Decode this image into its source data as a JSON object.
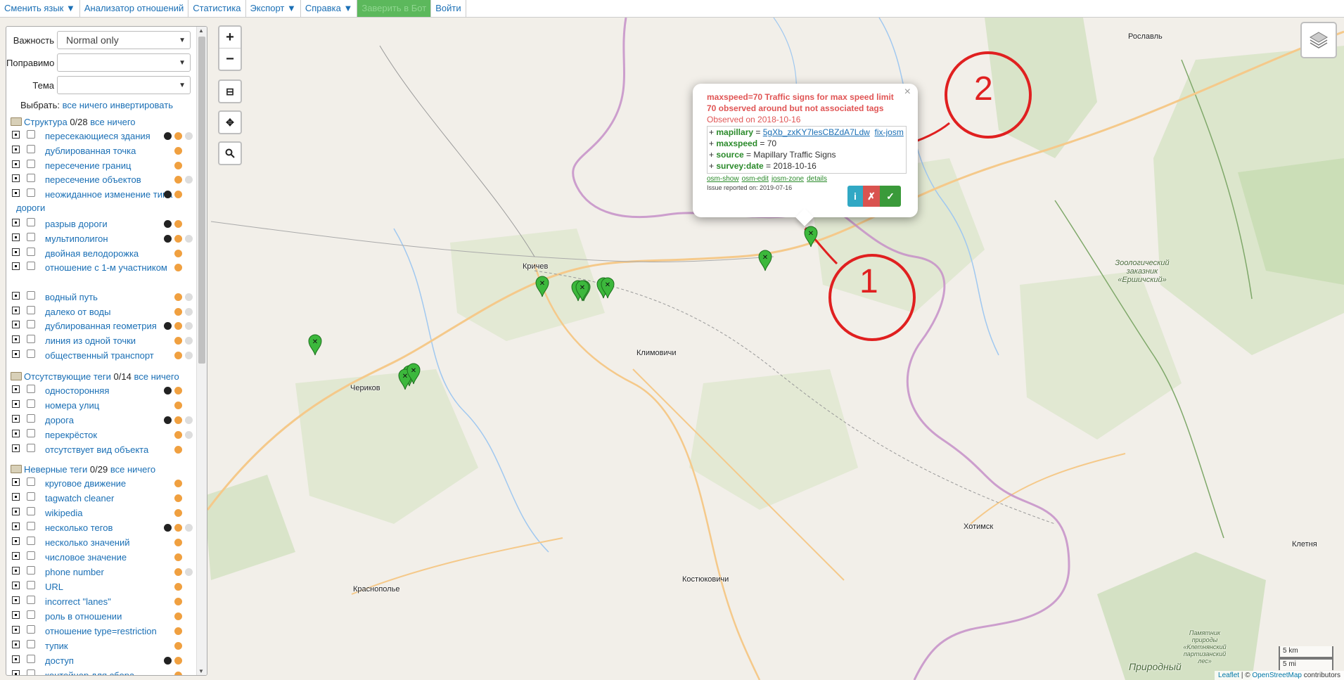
{
  "menu": [
    {
      "label": "Сменить язык ▼"
    },
    {
      "label": "Анализатор отношений"
    },
    {
      "label": "Статистика"
    },
    {
      "label": "Экспорт ▼"
    },
    {
      "label": "Справка ▼"
    },
    {
      "label": "Заверить в Бот"
    },
    {
      "label": "Войти"
    }
  ],
  "filters": {
    "importance": {
      "label": "Важность",
      "value": "Normal only"
    },
    "fixable": {
      "label": "Поправимо",
      "value": ""
    },
    "theme": {
      "label": "Тема",
      "value": ""
    },
    "choose": {
      "label": "Выбрать:",
      "all": "все",
      "none": "ничего",
      "invert": "инвертировать"
    }
  },
  "categories": [
    {
      "name": "Структура",
      "count": "0/28",
      "all": "все",
      "none": "ничего",
      "items": [
        {
          "label": "пересекающиеся здания",
          "dots": [
            "dark",
            "orange",
            "grey"
          ]
        },
        {
          "label": "дублированная точка",
          "dots": [
            "orange"
          ]
        },
        {
          "label": "пересечение границ",
          "dots": [
            "orange"
          ]
        },
        {
          "label": "пересечение объектов",
          "dots": [
            "orange",
            "grey"
          ]
        },
        {
          "label": "неожиданное изменение типа дороги",
          "dots": [
            "dark",
            "orange"
          ]
        },
        {
          "label": "разрыв дороги",
          "dots": [
            "dark",
            "orange"
          ]
        },
        {
          "label": "мультиполигон",
          "dots": [
            "dark",
            "orange",
            "grey"
          ]
        },
        {
          "label": "двойная велодорожка",
          "dots": [
            "orange"
          ]
        },
        {
          "label": "отношение с 1-м участником",
          "dots": [
            "orange"
          ]
        },
        {
          "label": "водный путь",
          "dots": [
            "orange",
            "grey"
          ]
        },
        {
          "label": "далеко от воды",
          "dots": [
            "orange",
            "grey"
          ]
        },
        {
          "label": "дублированная геометрия",
          "dots": [
            "dark",
            "orange",
            "grey"
          ]
        },
        {
          "label": "линия из одной точки",
          "dots": [
            "orange",
            "grey"
          ]
        },
        {
          "label": "общественный транспорт",
          "dots": [
            "orange",
            "grey"
          ]
        }
      ]
    },
    {
      "name": "Отсутствующие теги",
      "count": "0/14",
      "all": "все",
      "none": "ничего",
      "items": [
        {
          "label": "односторонняя",
          "dots": [
            "dark",
            "orange"
          ]
        },
        {
          "label": "номера улиц",
          "dots": [
            "orange"
          ]
        },
        {
          "label": "дорога",
          "dots": [
            "dark",
            "orange",
            "grey"
          ]
        },
        {
          "label": "перекрёсток",
          "dots": [
            "orange",
            "grey"
          ]
        },
        {
          "label": "отсутствует вид объекта",
          "dots": [
            "orange"
          ]
        }
      ]
    },
    {
      "name": "Неверные теги",
      "count": "0/29",
      "all": "все",
      "none": "ничего",
      "items": [
        {
          "label": "круговое движение",
          "dots": [
            "orange"
          ]
        },
        {
          "label": "tagwatch cleaner",
          "dots": [
            "orange"
          ]
        },
        {
          "label": "wikipedia",
          "dots": [
            "orange"
          ]
        },
        {
          "label": "несколько тегов",
          "dots": [
            "dark",
            "orange",
            "grey"
          ]
        },
        {
          "label": "несколько значений",
          "dots": [
            "orange"
          ]
        },
        {
          "label": "числовое значение",
          "dots": [
            "orange"
          ]
        },
        {
          "label": "phone number",
          "dots": [
            "orange",
            "grey"
          ]
        },
        {
          "label": "URL",
          "dots": [
            "orange"
          ]
        },
        {
          "label": "incorrect \"lanes\"",
          "dots": [
            "orange"
          ]
        },
        {
          "label": "роль в отношении",
          "dots": [
            "orange"
          ]
        },
        {
          "label": "отношение type=restriction",
          "dots": [
            "orange"
          ]
        },
        {
          "label": "тупик",
          "dots": [
            "orange"
          ]
        },
        {
          "label": "доступ",
          "dots": [
            "dark",
            "orange"
          ]
        },
        {
          "label": "контейнер для сбора",
          "dots": [
            "orange"
          ]
        }
      ]
    }
  ],
  "map": {
    "towns": [
      "Рославль",
      "Кричев",
      "Климовичи",
      "Чериков",
      "Хотимск",
      "Костюковичи",
      "Краснополье",
      "Клетня",
      "Зоологический заказник «Ершичский»",
      "Природный",
      "Памятник природы «Клетнянский партизанский лес»"
    ],
    "annotations": [
      "1",
      "2"
    ],
    "scale": [
      "5 km",
      "5 mi"
    ],
    "attribution": {
      "leaflet": "Leaflet",
      "sep": " | © ",
      "osm": "OpenStreetMap",
      "contributors": " contributors"
    }
  },
  "popup": {
    "title": "maxspeed=70 Traffic signs for max speed limit 70 observed around but not associated tags",
    "observed": "Observed on 2018-10-16",
    "tags": [
      {
        "key": "mapillary",
        "value": "5gXb_zxKY7lesCBZdA7Ldw",
        "link": "fix-josm"
      },
      {
        "key": "maxspeed",
        "value": "70"
      },
      {
        "key": "source",
        "value": "Mapillary Traffic Signs"
      },
      {
        "key": "survey:date",
        "value": "2018-10-16"
      }
    ],
    "links": [
      "osm-show",
      "osm-edit",
      "josm-zone",
      "details"
    ],
    "reported": "Issue reported on: 2019-07-16",
    "buttons": {
      "info": "i",
      "false_positive": "✗",
      "done": "✓"
    }
  }
}
